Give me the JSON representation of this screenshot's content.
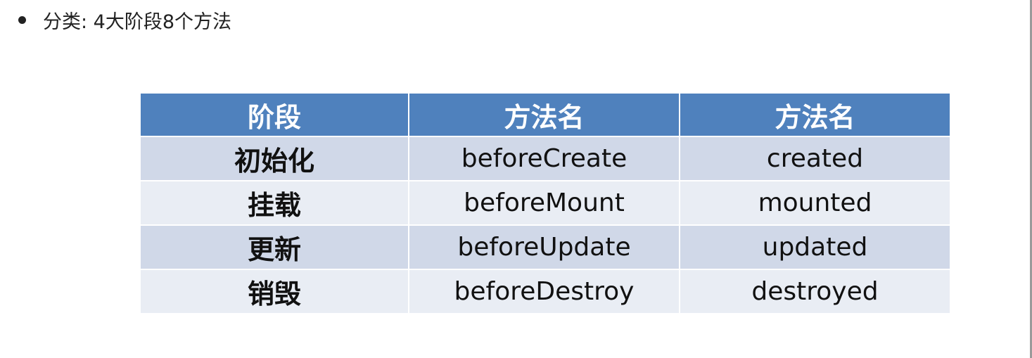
{
  "heading": {
    "bullet_text": "分类: 4大阶段8个方法"
  },
  "table": {
    "headers": [
      "阶段",
      "方法名",
      "方法名"
    ],
    "rows": [
      [
        "初始化",
        "beforeCreate",
        "created"
      ],
      [
        "挂载",
        "beforeMount",
        "mounted"
      ],
      [
        "更新",
        "beforeUpdate",
        "updated"
      ],
      [
        "销毁",
        "beforeDestroy",
        "destroyed"
      ]
    ]
  },
  "colors": {
    "header_bg": "#4f81bd",
    "row_odd_bg": "#d0d8e8",
    "row_even_bg": "#e9edf4",
    "header_text": "#ffffff"
  }
}
